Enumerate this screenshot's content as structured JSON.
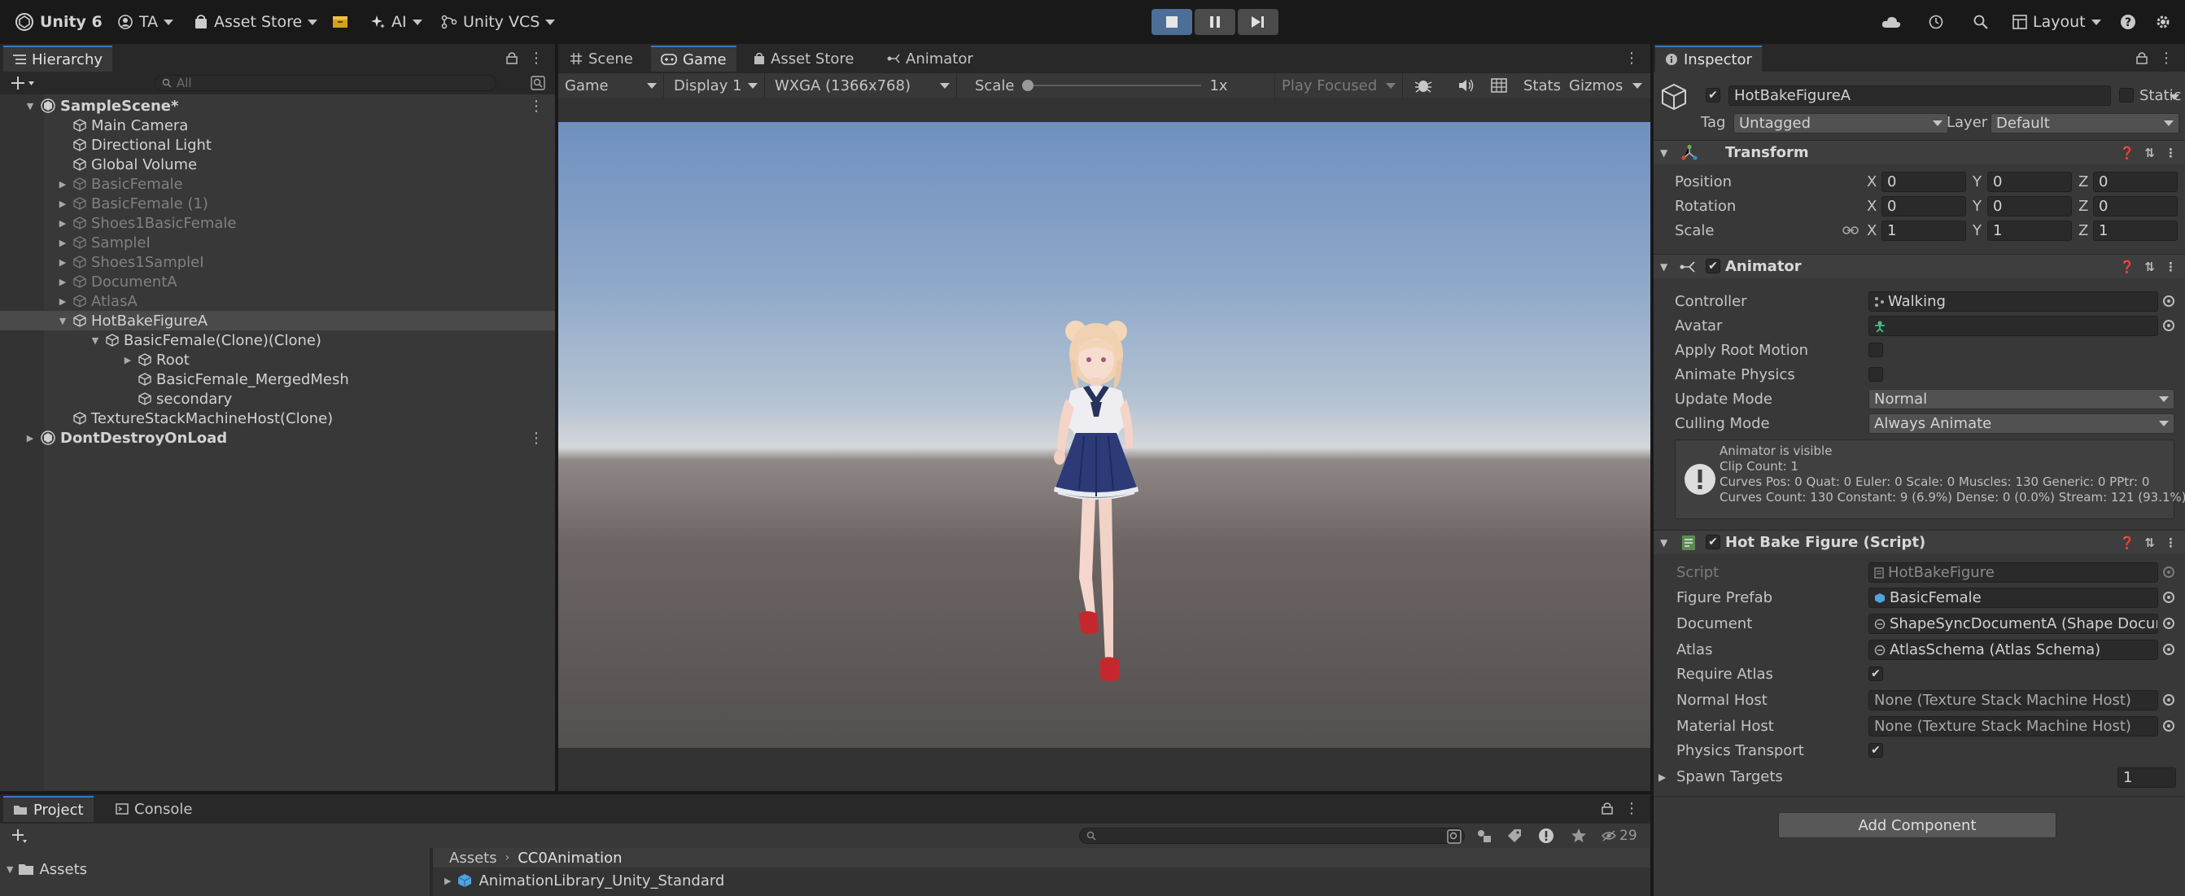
{
  "toolbar": {
    "product": "Unity 6",
    "account": "TA",
    "asset_store": "Asset Store",
    "ai": "AI",
    "vcs": "Unity VCS",
    "layout": "Layout"
  },
  "hierarchy": {
    "tab": "Hierarchy",
    "search_placeholder": "All",
    "rows": [
      {
        "label": "SampleScene*",
        "depth": 0,
        "arrow": "down",
        "kind": "scene",
        "dim": false,
        "selected": false,
        "kebab": true
      },
      {
        "label": "Main Camera",
        "depth": 1,
        "arrow": "",
        "kind": "cube",
        "dim": false,
        "selected": false,
        "kebab": false
      },
      {
        "label": "Directional Light",
        "depth": 1,
        "arrow": "",
        "kind": "cube",
        "dim": false,
        "selected": false,
        "kebab": false
      },
      {
        "label": "Global Volume",
        "depth": 1,
        "arrow": "",
        "kind": "cube",
        "dim": false,
        "selected": false,
        "kebab": false
      },
      {
        "label": "BasicFemale",
        "depth": 1,
        "arrow": "right",
        "kind": "cube",
        "dim": true,
        "selected": false,
        "kebab": false
      },
      {
        "label": "BasicFemale (1)",
        "depth": 1,
        "arrow": "right",
        "kind": "cube",
        "dim": true,
        "selected": false,
        "kebab": false
      },
      {
        "label": "Shoes1BasicFemale",
        "depth": 1,
        "arrow": "right",
        "kind": "cube",
        "dim": true,
        "selected": false,
        "kebab": false
      },
      {
        "label": "SampleI",
        "depth": 1,
        "arrow": "right",
        "kind": "cube",
        "dim": true,
        "selected": false,
        "kebab": false
      },
      {
        "label": "Shoes1SampleI",
        "depth": 1,
        "arrow": "right",
        "kind": "cube",
        "dim": true,
        "selected": false,
        "kebab": false
      },
      {
        "label": "DocumentA",
        "depth": 1,
        "arrow": "right",
        "kind": "cube",
        "dim": true,
        "selected": false,
        "kebab": false
      },
      {
        "label": "AtlasA",
        "depth": 1,
        "arrow": "right",
        "kind": "cube",
        "dim": true,
        "selected": false,
        "kebab": false
      },
      {
        "label": "HotBakeFigureA",
        "depth": 1,
        "arrow": "down",
        "kind": "cube",
        "dim": false,
        "selected": true,
        "kebab": false
      },
      {
        "label": "BasicFemale(Clone)(Clone)",
        "depth": 2,
        "arrow": "down",
        "kind": "cube",
        "dim": false,
        "selected": false,
        "kebab": false
      },
      {
        "label": "Root",
        "depth": 3,
        "arrow": "right",
        "kind": "cube",
        "dim": false,
        "selected": false,
        "kebab": false
      },
      {
        "label": "BasicFemale_MergedMesh",
        "depth": 3,
        "arrow": "",
        "kind": "cube",
        "dim": false,
        "selected": false,
        "kebab": false
      },
      {
        "label": "secondary",
        "depth": 3,
        "arrow": "",
        "kind": "cube",
        "dim": false,
        "selected": false,
        "kebab": false
      },
      {
        "label": "TextureStackMachineHost(Clone)",
        "depth": 1,
        "arrow": "",
        "kind": "cube",
        "dim": false,
        "selected": false,
        "kebab": false
      },
      {
        "label": "DontDestroyOnLoad",
        "depth": 0,
        "arrow": "right",
        "kind": "scene",
        "dim": false,
        "selected": false,
        "kebab": true
      }
    ]
  },
  "center_tabs": {
    "scene": "Scene",
    "game": "Game",
    "asset_store": "Asset Store",
    "animator": "Animator"
  },
  "game_toolbar": {
    "mode": "Game",
    "display": "Display 1",
    "resolution": "WXGA (1366x768)",
    "scale_label": "Scale",
    "scale_value": "1x",
    "scale_level": 0.0,
    "play_focused": "Play Focused",
    "stats": "Stats",
    "gizmos": "Gizmos"
  },
  "inspector": {
    "tab": "Inspector",
    "object_name": "HotBakeFigureA",
    "static_label": "Static",
    "tag_label": "Tag",
    "tag_value": "Untagged",
    "layer_label": "Layer",
    "layer_value": "Default",
    "transform": {
      "title": "Transform",
      "position_label": "Position",
      "rotation_label": "Rotation",
      "scale_label": "Scale",
      "position": {
        "x": "0",
        "y": "0",
        "z": "0"
      },
      "rotation": {
        "x": "0",
        "y": "0",
        "z": "0"
      },
      "scale": {
        "x": "1",
        "y": "1",
        "z": "1"
      },
      "axis_x": "X",
      "axis_y": "Y",
      "axis_z": "Z"
    },
    "animator": {
      "title": "Animator",
      "controller_label": "Controller",
      "controller_value": "Walking",
      "avatar_label": "Avatar",
      "avatar_value": "",
      "apply_root_motion_label": "Apply Root Motion",
      "animate_physics_label": "Animate Physics",
      "update_mode_label": "Update Mode",
      "update_mode_value": "Normal",
      "culling_mode_label": "Culling Mode",
      "culling_mode_value": "Always Animate",
      "info_line1": "Animator is visible",
      "info_line2": "Clip Count: 1",
      "info_line3": "Curves Pos: 0 Quat: 0 Euler: 0 Scale: 0 Muscles: 130 Generic: 0 PPtr: 0",
      "info_line4": "Curves Count: 130 Constant: 9 (6.9%) Dense: 0 (0.0%) Stream: 121 (93.1%)"
    },
    "hot_bake": {
      "title": "Hot Bake Figure (Script)",
      "script_label": "Script",
      "script_value": "HotBakeFigure",
      "figure_prefab_label": "Figure Prefab",
      "figure_prefab_value": "BasicFemale",
      "document_label": "Document",
      "document_value": "ShapeSyncDocumentA (Shape Docum",
      "atlas_label": "Atlas",
      "atlas_value": "AtlasSchema (Atlas Schema)",
      "require_atlas_label": "Require Atlas",
      "normal_host_label": "Normal Host",
      "normal_host_value": "None (Texture Stack Machine Host)",
      "material_host_label": "Material Host",
      "material_host_value": "None (Texture Stack Machine Host)",
      "physics_transport_label": "Physics Transport",
      "spawn_targets_label": "Spawn Targets",
      "spawn_targets_value": "1"
    },
    "add_component": "Add Component"
  },
  "project": {
    "tab_project": "Project",
    "tab_console": "Console",
    "hidden_count": "29",
    "tree_root": "Assets",
    "breadcrumb_root": "Assets",
    "breadcrumb_current": "CC0Animation",
    "item1": "AnimationLibrary_Unity_Standard"
  },
  "colors": {
    "accent": "#3a79bb",
    "play_button_active": "#4d6f97",
    "panel_bg": "#383838",
    "toolbar_bg": "#191919"
  }
}
